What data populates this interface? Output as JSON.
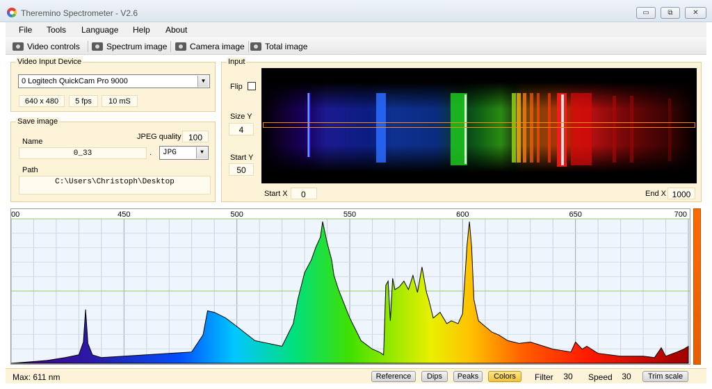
{
  "window": {
    "title": "Theremino Spectrometer - V2.6",
    "min_symbol": "▭",
    "max_symbol": "⧉",
    "close_symbol": "✕"
  },
  "menu": [
    "File",
    "Tools",
    "Language",
    "Help",
    "About"
  ],
  "toolbar": [
    "Video controls",
    "Spectrum image",
    "Camera image",
    "Total image"
  ],
  "video_input": {
    "title": "Video Input Device",
    "device": "0 Logitech QuickCam Pro 9000",
    "resolution": "640 x 480",
    "fps": "5 fps",
    "exposure": "10 mS"
  },
  "save_image": {
    "title": "Save image",
    "name_label": "Name",
    "name_value": "0_33",
    "dot": ".",
    "format": "JPG",
    "quality_label": "JPEG quality",
    "quality_value": "100",
    "path_label": "Path",
    "path_value": "C:\\Users\\Christoph\\Desktop"
  },
  "input": {
    "title": "Input",
    "flip_label": "Flip",
    "size_y_label": "Size Y",
    "size_y_value": "4",
    "start_y_label": "Start Y",
    "start_y_value": "50",
    "start_x_label": "Start X",
    "start_x_value": "0",
    "end_x_label": "End X",
    "end_x_value": "1000"
  },
  "chart_data": {
    "type": "area",
    "xlim": [
      400,
      700
    ],
    "ylim": [
      0,
      100
    ],
    "x_ticks": [
      450,
      500,
      550,
      600,
      650,
      700
    ],
    "x_tick_labels": [
      "00",
      "450",
      "500",
      "550",
      "600",
      "650",
      "700"
    ],
    "grid": true,
    "x": [
      400,
      408,
      416,
      424,
      430,
      432,
      433,
      434,
      436,
      440,
      450,
      460,
      480,
      485,
      487,
      490,
      495,
      500,
      508,
      520,
      525,
      527,
      530,
      533,
      535,
      537,
      538,
      540,
      542,
      543,
      545,
      550,
      555,
      560,
      563,
      565,
      566,
      567,
      568,
      569,
      570,
      572,
      574,
      576,
      578,
      580,
      582,
      584,
      585,
      587,
      590,
      593,
      595,
      598,
      600,
      602,
      603,
      604,
      605,
      607,
      610,
      613,
      616,
      620,
      625,
      630,
      640,
      648,
      650,
      653,
      655,
      660,
      665,
      670,
      675,
      680,
      685,
      688,
      690,
      695,
      698,
      700
    ],
    "values": [
      0,
      1,
      2,
      4,
      6,
      15,
      38,
      14,
      6,
      4,
      5,
      6,
      8,
      20,
      37,
      36,
      32,
      26,
      16,
      12,
      28,
      45,
      64,
      73,
      82,
      89,
      100,
      85,
      73,
      62,
      52,
      32,
      16,
      10,
      8,
      6,
      55,
      58,
      30,
      60,
      52,
      54,
      58,
      52,
      62,
      50,
      68,
      50,
      45,
      32,
      36,
      28,
      30,
      28,
      35,
      84,
      100,
      82,
      45,
      30,
      26,
      22,
      20,
      16,
      14,
      15,
      10,
      8,
      15,
      10,
      12,
      7,
      6,
      5,
      5,
      5,
      4,
      11,
      5,
      8,
      10,
      12
    ],
    "max_label": "Max: 611 nm"
  },
  "bottom": {
    "buttons": [
      "Reference",
      "Dips",
      "Peaks",
      "Colors"
    ],
    "active_button": "Colors",
    "filter_label": "Filter",
    "filter_value": "30",
    "speed_label": "Speed",
    "speed_value": "30",
    "trim_button": "Trim scale"
  }
}
